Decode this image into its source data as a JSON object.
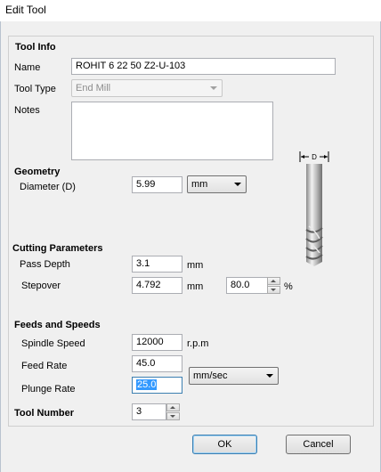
{
  "window": {
    "title": "Edit Tool"
  },
  "tool_info": {
    "section_label": "Tool Info",
    "name_label": "Name",
    "name_value": "ROHIT 6 22 50   Z2-U-103",
    "tool_type_label": "Tool Type",
    "tool_type_value": "End Mill",
    "notes_label": "Notes",
    "notes_value": ""
  },
  "geometry": {
    "section_label": "Geometry",
    "diameter_label": "Diameter (D)",
    "diameter_value": "5.99",
    "unit_value": "mm",
    "diagram_label": "D"
  },
  "cutting": {
    "section_label": "Cutting Parameters",
    "pass_depth_label": "Pass Depth",
    "pass_depth_value": "3.1",
    "pass_depth_unit": "mm",
    "stepover_label": "Stepover",
    "stepover_value": "4.792",
    "stepover_unit": "mm",
    "stepover_percent_value": "80.0",
    "percent_symbol": "%"
  },
  "feeds": {
    "section_label": "Feeds and Speeds",
    "spindle_label": "Spindle Speed",
    "spindle_value": "12000",
    "spindle_unit": "r.p.m",
    "feed_label": "Feed Rate",
    "feed_value": "45.0",
    "plunge_label": "Plunge Rate",
    "plunge_value": "25.0",
    "rate_unit_value": "mm/sec"
  },
  "tool_number": {
    "label": "Tool Number",
    "value": "3"
  },
  "buttons": {
    "ok": "OK",
    "cancel": "Cancel"
  },
  "icons": {
    "tool_image": "end-mill-tool-icon",
    "dropdown": "chevron-down-icon",
    "spin_up": "spin-up-icon",
    "spin_down": "spin-down-icon"
  },
  "colors": {
    "focus_border": "#3c7fb1",
    "selection": "#3399ff"
  }
}
